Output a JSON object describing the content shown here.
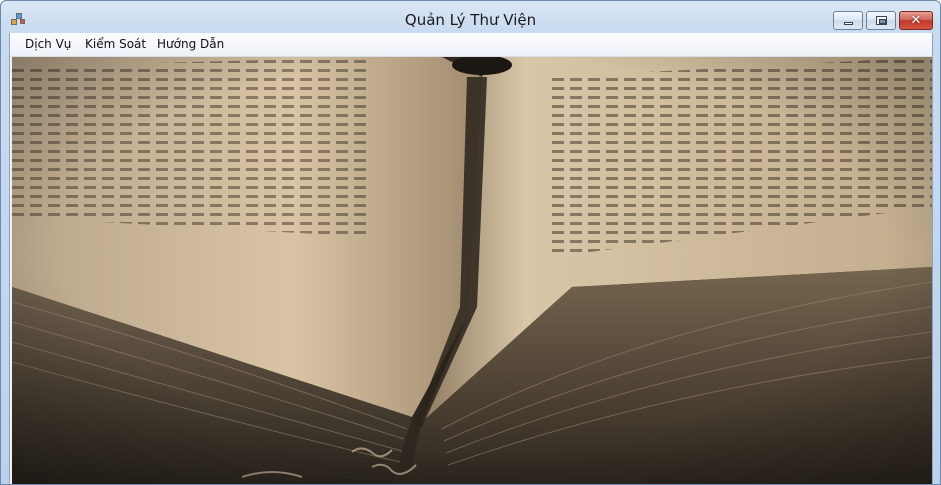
{
  "window": {
    "title": "Quản Lý Thư Viện",
    "controls": {
      "minimize_icon": "minimize-icon",
      "maximize_icon": "maximize-icon",
      "close_icon": "close-icon",
      "close_glyph": "✕"
    }
  },
  "menu": {
    "items": [
      {
        "label": "Dịch Vụ"
      },
      {
        "label": "Kiểm Soát"
      },
      {
        "label": "Hướng Dẫn"
      }
    ]
  },
  "background": {
    "image": "open-old-book-photo",
    "tone": "sepia"
  },
  "colors": {
    "titlebar": "#c9dbf0",
    "close_button": "#c23b2c",
    "paper": "#d8c1a0",
    "shadow": "#2a241d"
  }
}
